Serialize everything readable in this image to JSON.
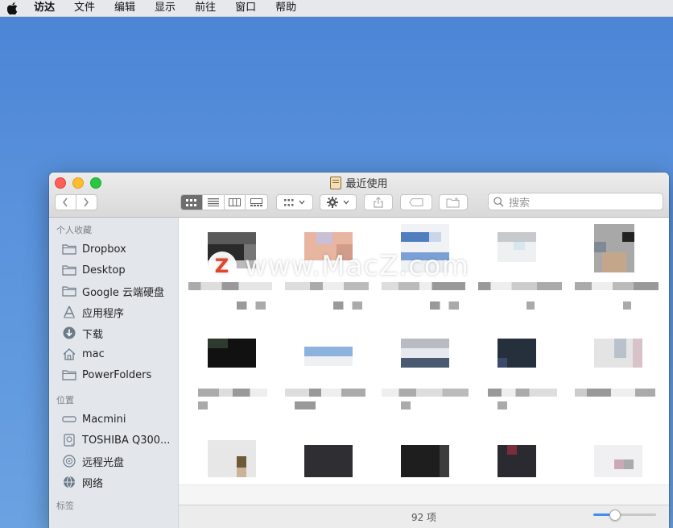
{
  "menubar": {
    "items": [
      "访达",
      "文件",
      "编辑",
      "显示",
      "前往",
      "窗口",
      "帮助"
    ]
  },
  "window": {
    "title": "最近使用",
    "search_placeholder": "搜索",
    "status": "92 项",
    "icon_size_level": 0.3
  },
  "sidebar": {
    "favorites_header": "个人收藏",
    "favorites": [
      {
        "label": "Dropbox",
        "icon": "folder-icon"
      },
      {
        "label": "Desktop",
        "icon": "folder-icon"
      },
      {
        "label": "Google 云端硬盘",
        "icon": "folder-icon"
      },
      {
        "label": "应用程序",
        "icon": "applications-icon"
      },
      {
        "label": "下载",
        "icon": "download-icon"
      },
      {
        "label": "mac",
        "icon": "home-icon"
      },
      {
        "label": "PowerFolders",
        "icon": "folder-icon"
      }
    ],
    "locations_header": "位置",
    "locations": [
      {
        "label": "Macmini",
        "icon": "computer-icon"
      },
      {
        "label": "TOSHIBA Q300...",
        "icon": "disk-icon"
      },
      {
        "label": "远程光盘",
        "icon": "optical-disc-icon"
      },
      {
        "label": "网络",
        "icon": "network-icon"
      }
    ],
    "tags_header": "标签"
  },
  "watermark": {
    "logo_letter": "Z",
    "text": "www.MacZ.com"
  },
  "colors": {
    "desktop": "#5a92dc",
    "sidebar": "#e3e7ec",
    "accent": "#3d8ef5"
  }
}
